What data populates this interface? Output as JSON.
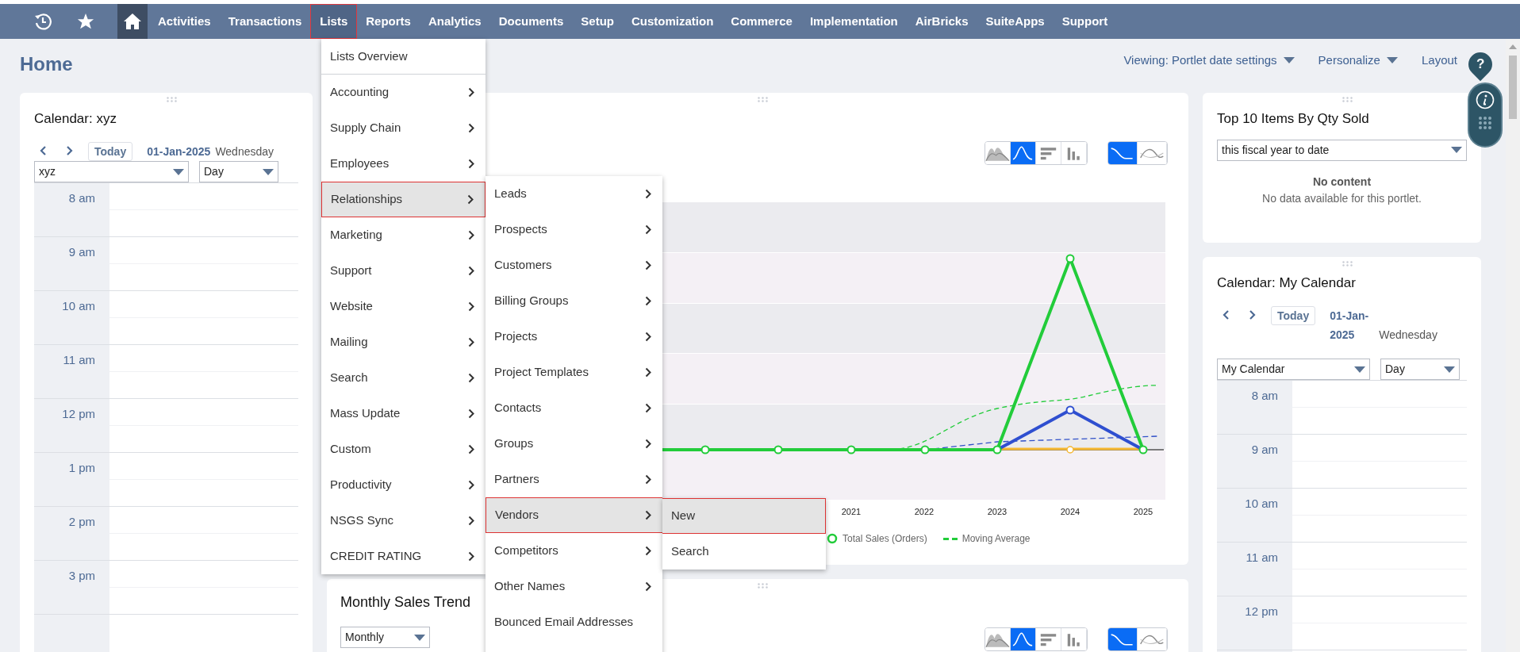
{
  "nav": {
    "home": {
      "selected": true
    },
    "items": [
      {
        "label": "Activities",
        "selected": false
      },
      {
        "label": "Transactions",
        "selected": false
      },
      {
        "label": "Lists",
        "selected": true
      },
      {
        "label": "Reports",
        "selected": false
      },
      {
        "label": "Analytics",
        "selected": false
      },
      {
        "label": "Documents",
        "selected": false
      },
      {
        "label": "Setup",
        "selected": false
      },
      {
        "label": "Customization",
        "selected": false
      },
      {
        "label": "Commerce",
        "selected": false
      },
      {
        "label": "Implementation",
        "selected": false
      },
      {
        "label": "AirBricks",
        "selected": false
      },
      {
        "label": "SuiteApps",
        "selected": false
      },
      {
        "label": "Support",
        "selected": false
      }
    ]
  },
  "page_title": "Home",
  "header_links": [
    {
      "label": "Viewing: Portlet date settings",
      "dropdown": true
    },
    {
      "label": "Personalize",
      "dropdown": true
    },
    {
      "label": "Layout",
      "dropdown": false
    }
  ],
  "help_marker": "?",
  "left_calendar": {
    "title": "Calendar: xyz",
    "today": "Today",
    "date": "01-Jan-2025",
    "weekday": "Wednesday",
    "calendar_select": "xyz",
    "view_select": "Day",
    "hours": [
      "8 am",
      "9 am",
      "10 am",
      "11 am",
      "12 pm",
      "1 pm",
      "2 pm",
      "3 pm"
    ]
  },
  "sales_chart": {
    "chart_types": [
      {
        "kind": "area",
        "selected": false
      },
      {
        "kind": "line",
        "selected": true
      },
      {
        "kind": "hbar",
        "selected": false
      },
      {
        "kind": "vbar",
        "selected": false
      }
    ],
    "line_styles": [
      {
        "kind": "smooth",
        "selected": true
      },
      {
        "kind": "wave",
        "selected": false
      }
    ],
    "x_labels": [
      "2021",
      "2022",
      "2023",
      "2024",
      "2025"
    ],
    "legend": [
      {
        "label": "Total Sales (Orders)",
        "kind": "marker",
        "color": "#22cc3a"
      },
      {
        "label": "Moving Average",
        "kind": "dashed",
        "color": "#22cc3a"
      }
    ]
  },
  "monthly_trend": {
    "title": "Monthly Sales Trend",
    "period_select": "Monthly",
    "chart_types": [
      {
        "kind": "area",
        "selected": false
      },
      {
        "kind": "line",
        "selected": true
      },
      {
        "kind": "hbar",
        "selected": false
      },
      {
        "kind": "vbar",
        "selected": false
      }
    ],
    "line_styles": [
      {
        "kind": "smooth",
        "selected": true
      },
      {
        "kind": "wave",
        "selected": false
      }
    ]
  },
  "top_items": {
    "title": "Top 10 Items By Qty Sold",
    "period_select": "this fiscal year to date",
    "empty_title": "No content",
    "empty_message": "No data available for this portlet."
  },
  "my_calendar": {
    "title": "Calendar: My Calendar",
    "today": "Today",
    "date": "01-Jan-2025",
    "weekday": "Wednesday",
    "calendar_select": "My Calendar",
    "view_select": "Day",
    "hours": [
      "8 am",
      "9 am",
      "10 am",
      "11 am",
      "12 pm"
    ]
  },
  "lists_menu": {
    "items": [
      {
        "label": "Lists Overview",
        "kind": "overview",
        "selected": false
      },
      {
        "label": "Accounting",
        "kind": "submenu",
        "selected": false
      },
      {
        "label": "Supply Chain",
        "kind": "submenu",
        "selected": false
      },
      {
        "label": "Employees",
        "kind": "submenu",
        "selected": false
      },
      {
        "label": "Relationships",
        "kind": "submenu",
        "selected": true
      },
      {
        "label": "Marketing",
        "kind": "submenu",
        "selected": false
      },
      {
        "label": "Support",
        "kind": "submenu",
        "selected": false
      },
      {
        "label": "Website",
        "kind": "submenu",
        "selected": false
      },
      {
        "label": "Mailing",
        "kind": "submenu",
        "selected": false
      },
      {
        "label": "Search",
        "kind": "submenu",
        "selected": false
      },
      {
        "label": "Mass Update",
        "kind": "submenu",
        "selected": false
      },
      {
        "label": "Custom",
        "kind": "submenu",
        "selected": false
      },
      {
        "label": "Productivity",
        "kind": "submenu",
        "selected": false
      },
      {
        "label": "NSGS Sync",
        "kind": "submenu",
        "selected": false
      },
      {
        "label": "CREDIT RATING",
        "kind": "submenu",
        "selected": false
      }
    ]
  },
  "relationships_menu": {
    "items": [
      {
        "label": "Leads",
        "kind": "submenu",
        "selected": false
      },
      {
        "label": "Prospects",
        "kind": "submenu",
        "selected": false
      },
      {
        "label": "Customers",
        "kind": "submenu",
        "selected": false
      },
      {
        "label": "Billing Groups",
        "kind": "submenu",
        "selected": false
      },
      {
        "label": "Projects",
        "kind": "submenu",
        "selected": false
      },
      {
        "label": "Project Templates",
        "kind": "submenu",
        "selected": false
      },
      {
        "label": "Contacts",
        "kind": "submenu",
        "selected": false
      },
      {
        "label": "Groups",
        "kind": "submenu",
        "selected": false
      },
      {
        "label": "Partners",
        "kind": "submenu",
        "selected": false
      },
      {
        "label": "Vendors",
        "kind": "submenu",
        "selected": true
      },
      {
        "label": "Competitors",
        "kind": "submenu",
        "selected": false
      },
      {
        "label": "Other Names",
        "kind": "submenu",
        "selected": false
      },
      {
        "label": "Bounced Email Addresses",
        "kind": "link",
        "selected": false
      }
    ]
  },
  "vendors_menu": {
    "items": [
      {
        "label": "New",
        "kind": "link",
        "selected": true
      },
      {
        "label": "Search",
        "kind": "link",
        "selected": false
      }
    ]
  }
}
